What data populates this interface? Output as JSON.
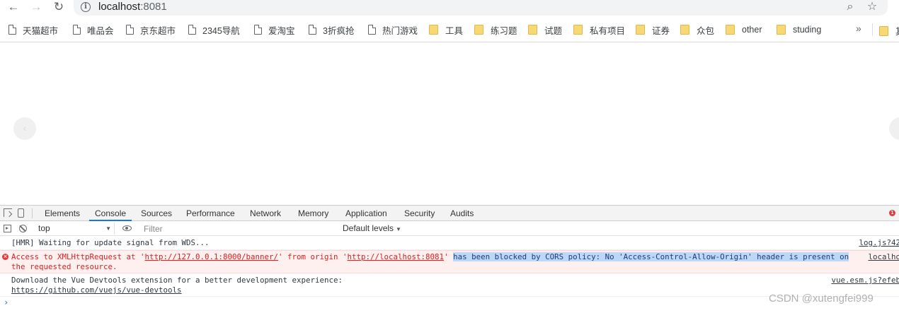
{
  "browser": {
    "url_host": "localhost",
    "url_port": ":8081",
    "icons": {
      "back": "arrow-left-icon",
      "forward": "arrow-right-icon",
      "reload": "reload-icon",
      "site_info": "info-icon",
      "zoom": "zoom-icon",
      "bookmark_star": "star-icon"
    }
  },
  "bookmarks": {
    "items": [
      {
        "label": "天猫超市",
        "type": "page"
      },
      {
        "label": "唯品会",
        "type": "page"
      },
      {
        "label": "京东超市",
        "type": "page"
      },
      {
        "label": "2345导航",
        "type": "page"
      },
      {
        "label": "爱淘宝",
        "type": "page"
      },
      {
        "label": "3折疯抢",
        "type": "page"
      },
      {
        "label": "热门游戏",
        "type": "page"
      },
      {
        "label": "工具",
        "type": "folder"
      },
      {
        "label": "练习题",
        "type": "folder"
      },
      {
        "label": "试题",
        "type": "folder"
      },
      {
        "label": "私有项目",
        "type": "folder"
      },
      {
        "label": "证券",
        "type": "folder"
      },
      {
        "label": "众包",
        "type": "folder"
      },
      {
        "label": "other",
        "type": "folder"
      },
      {
        "label": "studing",
        "type": "folder"
      }
    ],
    "more": "»",
    "overflow_folder_label": "其"
  },
  "page": {
    "carousel_prev": "‹"
  },
  "devtools": {
    "tabs": [
      "Elements",
      "Console",
      "Sources",
      "Performance",
      "Network",
      "Memory",
      "Application",
      "Security",
      "Audits"
    ],
    "active_tab": "Console",
    "error_count": "1",
    "context": "top",
    "filter_placeholder": "Filter",
    "levels_label": "Default levels",
    "messages": {
      "hmr": {
        "text": "[HMR] Waiting for update signal from WDS...",
        "source": "log.js?42"
      },
      "error": {
        "prefix": "Access to XMLHttpRequest at '",
        "url1": "http://127.0.0.1:8000/banner/",
        "middle": "' from origin '",
        "url2": "http://localhost:8081",
        "suffix": "' ",
        "highlighted": "has been blocked by CORS policy: No 'Access-Control-Allow-Origin' header is present on",
        "line2": "the requested resource.",
        "source": "localho"
      },
      "devtools": {
        "text": "Download the Vue Devtools extension for a better development experience:",
        "link": "https://github.com/vuejs/vue-devtools",
        "source": "vue.esm.js?efeb"
      }
    },
    "prompt": "›"
  },
  "watermark": "CSDN @xutengfei999",
  "colors": {
    "accent": "#1a73e8",
    "error": "#e31c1c",
    "error_bg": "#fff0f0",
    "folder": "#f8d775",
    "highlight": "#bcd7f7"
  }
}
